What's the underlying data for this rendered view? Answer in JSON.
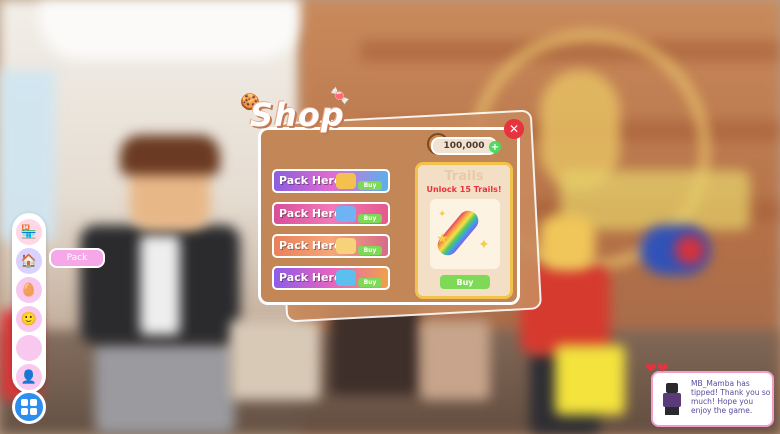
{
  "shop": {
    "title": "Shop",
    "currency_amount": "100,000",
    "packs": [
      {
        "label": "Pack Here",
        "buy_label": "Buy",
        "color": "#b56ae0"
      },
      {
        "label": "Pack Here",
        "buy_label": "Buy",
        "color": "#e25aa0"
      },
      {
        "label": "Pack Here",
        "buy_label": "Buy",
        "color": "#f08a5d"
      },
      {
        "label": "Pack Here",
        "buy_label": "Buy",
        "color": "#9d6ee8"
      }
    ],
    "trails": {
      "title": "Trails",
      "subtitle": "Unlock 15 Trails!",
      "buy_label": "Buy"
    }
  },
  "side_menu": {
    "tooltip": "Pack",
    "icons": [
      "shop-icon",
      "house-icon",
      "egg-icon",
      "avatar-icon",
      "blank-icon",
      "friend-icon"
    ]
  },
  "notification": {
    "text": "MB_Mamba has tipped! Thank you so much! Hope you enjoy the game."
  },
  "colors": {
    "panel": "#c28657",
    "buy_green": "#7ed957",
    "close_red": "#e8323d",
    "menu_blue": "#2e8ef0",
    "tooltip_pink": "#f6a7e8"
  }
}
